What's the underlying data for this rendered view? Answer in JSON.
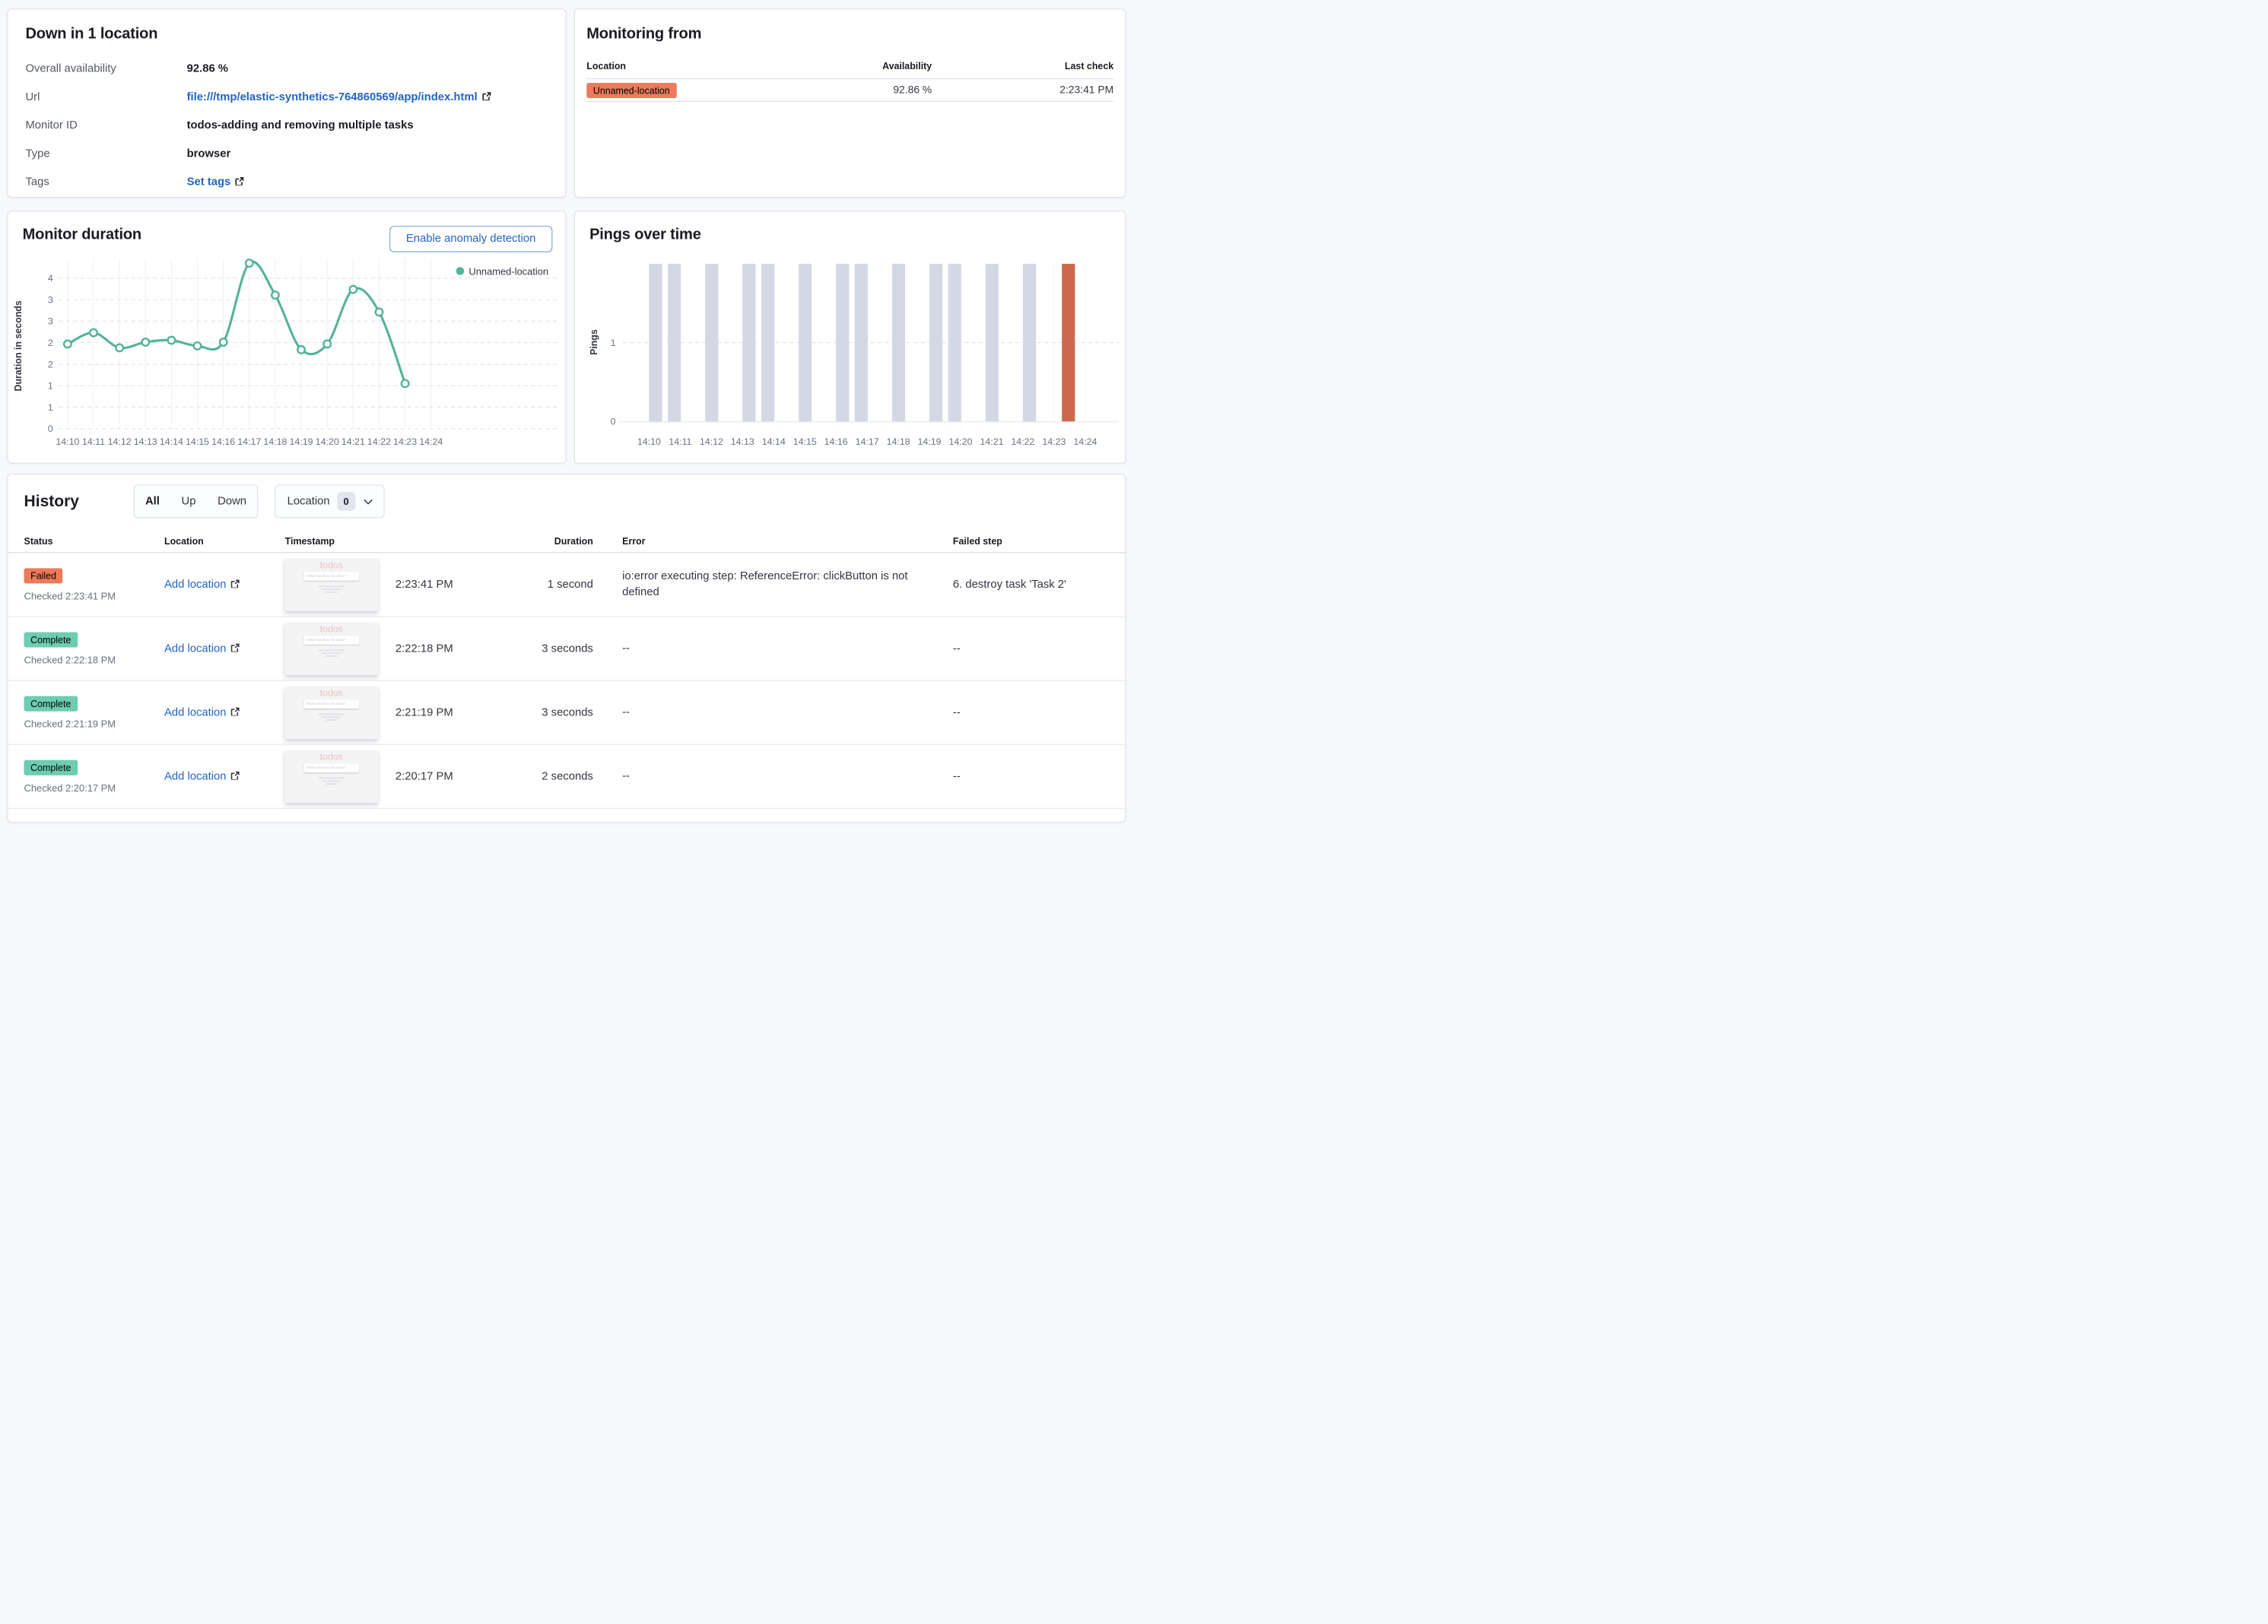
{
  "status_panel": {
    "title": "Down in 1 location",
    "items": [
      {
        "label": "Overall availability",
        "value": "92.86 %",
        "link": false
      },
      {
        "label": "Url",
        "value": "file:///tmp/elastic-synthetics-764860569/app/index.html",
        "link": true
      },
      {
        "label": "Monitor ID",
        "value": "todos-adding and removing multiple tasks",
        "link": false
      },
      {
        "label": "Type",
        "value": "browser",
        "link": false
      },
      {
        "label": "Tags",
        "value": "Set tags",
        "link": true
      }
    ]
  },
  "monitoring_from": {
    "title": "Monitoring from",
    "columns": [
      "Location",
      "Availability",
      "Last check"
    ],
    "rows": [
      {
        "location": "Unnamed-location",
        "status": "down",
        "availability": "92.86 %",
        "last_check": "2:23:41 PM"
      }
    ]
  },
  "duration_panel": {
    "title": "Monitor duration",
    "button_label": "Enable anomaly detection",
    "legend": [
      {
        "label": "Unnamed-location",
        "color": "#54B399"
      }
    ]
  },
  "pings_panel": {
    "title": "Pings over time"
  },
  "chart_data": [
    {
      "id": "monitor_duration",
      "type": "line",
      "title": "Monitor duration",
      "xlabel": "",
      "ylabel": "Duration in seconds",
      "x_ticks": [
        "14:10",
        "14:11",
        "14:12",
        "14:13",
        "14:14",
        "14:15",
        "14:16",
        "14:17",
        "14:18",
        "14:19",
        "14:20",
        "14:21",
        "14:22",
        "14:23",
        "14:24"
      ],
      "series": [
        {
          "name": "Unnamed-location",
          "color": "#54B399",
          "x": [
            "14:10",
            "14:11",
            "14:12",
            "14:13",
            "14:14",
            "14:15",
            "14:16",
            "14:17",
            "14:18",
            "14:19",
            "14:20",
            "14:21",
            "14:22",
            "14:23"
          ],
          "values": [
            2.25,
            2.55,
            2.15,
            2.3,
            2.35,
            2.2,
            2.3,
            4.4,
            3.55,
            2.1,
            2.25,
            3.7,
            3.1,
            1.2
          ]
        }
      ],
      "ylim": [
        0,
        4.45
      ],
      "y_ticks": [
        {
          "v": 4,
          "label": "4"
        },
        {
          "v": 3.43,
          "label": "3"
        },
        {
          "v": 2.86,
          "label": "3"
        },
        {
          "v": 2.29,
          "label": "2"
        },
        {
          "v": 1.71,
          "label": "2"
        },
        {
          "v": 1.14,
          "label": "1"
        },
        {
          "v": 0.57,
          "label": "1"
        },
        {
          "v": 0,
          "label": "0"
        }
      ],
      "grid": {
        "vertical": "solid",
        "horizontal": "dashed"
      },
      "legend_position": "top-right"
    },
    {
      "id": "pings_over_time",
      "type": "bar",
      "title": "Pings over time",
      "xlabel": "",
      "ylabel": "Pings",
      "x_ticks": [
        "14:10",
        "14:11",
        "14:12",
        "14:13",
        "14:14",
        "14:15",
        "14:16",
        "14:17",
        "14:18",
        "14:19",
        "14:20",
        "14:21",
        "14:22",
        "14:23",
        "14:24"
      ],
      "y_ticks": [
        {
          "v": 1,
          "label": "1"
        },
        {
          "v": 0,
          "label": "0"
        }
      ],
      "ylim": [
        0,
        2
      ],
      "bar_render_value": 2,
      "bar_width_minutes": 0.42,
      "bars": [
        {
          "offset_minutes": 0.0,
          "pings": 1,
          "status": "up"
        },
        {
          "offset_minutes": 0.6,
          "pings": 1,
          "status": "up"
        },
        {
          "offset_minutes": 1.8,
          "pings": 1,
          "status": "up"
        },
        {
          "offset_minutes": 3.0,
          "pings": 1,
          "status": "up"
        },
        {
          "offset_minutes": 3.6,
          "pings": 1,
          "status": "up"
        },
        {
          "offset_minutes": 4.8,
          "pings": 1,
          "status": "up"
        },
        {
          "offset_minutes": 6.0,
          "pings": 1,
          "status": "up"
        },
        {
          "offset_minutes": 6.6,
          "pings": 1,
          "status": "up"
        },
        {
          "offset_minutes": 7.8,
          "pings": 1,
          "status": "up"
        },
        {
          "offset_minutes": 9.0,
          "pings": 1,
          "status": "up"
        },
        {
          "offset_minutes": 9.6,
          "pings": 1,
          "status": "up"
        },
        {
          "offset_minutes": 10.8,
          "pings": 1,
          "status": "up"
        },
        {
          "offset_minutes": 12.0,
          "pings": 1,
          "status": "up"
        },
        {
          "offset_minutes": 13.25,
          "pings": 1,
          "status": "down"
        }
      ],
      "colors": {
        "up": "#D3D8E4",
        "down": "#CE6951"
      }
    }
  ],
  "history": {
    "title": "History",
    "status_filter": {
      "options": [
        "All",
        "Up",
        "Down"
      ],
      "selected": "All"
    },
    "location_filter": {
      "label": "Location",
      "count": "0"
    },
    "columns": [
      "Status",
      "Location",
      "Timestamp",
      "Duration",
      "Error",
      "Failed step"
    ],
    "rows": [
      {
        "status_label": "Failed",
        "status": "down",
        "checked": "Checked 2:23:41 PM",
        "location_link": "Add location",
        "timestamp": "2:23:41 PM",
        "duration": "1 second",
        "error": "io:error executing step: ReferenceError: clickButton is not defined",
        "failed_step": "6. destroy task 'Task 2'"
      },
      {
        "status_label": "Complete",
        "status": "up",
        "checked": "Checked 2:22:18 PM",
        "location_link": "Add location",
        "timestamp": "2:22:18 PM",
        "duration": "3 seconds",
        "error": "--",
        "failed_step": "--"
      },
      {
        "status_label": "Complete",
        "status": "up",
        "checked": "Checked 2:21:19 PM",
        "location_link": "Add location",
        "timestamp": "2:21:19 PM",
        "duration": "3 seconds",
        "error": "--",
        "failed_step": "--"
      },
      {
        "status_label": "Complete",
        "status": "up",
        "checked": "Checked 2:20:17 PM",
        "location_link": "Add location",
        "timestamp": "2:20:17 PM",
        "duration": "2 seconds",
        "error": "--",
        "failed_step": "--"
      }
    ],
    "thumbnail": {
      "app_title": "todos",
      "input_placeholder": "What needs to be done?"
    }
  },
  "icons": {
    "external_link_icon": "boxed arrow up-right",
    "chevron_down_icon": "v",
    "legend_dot_icon": "filled circle"
  },
  "colors": {
    "fail_badge": "#EC7A5C",
    "success_badge": "#6DCCB1",
    "link": "#2366BE",
    "line_series": "#54B399",
    "bar_up": "#D3D8E4",
    "bar_down": "#CE6951"
  }
}
